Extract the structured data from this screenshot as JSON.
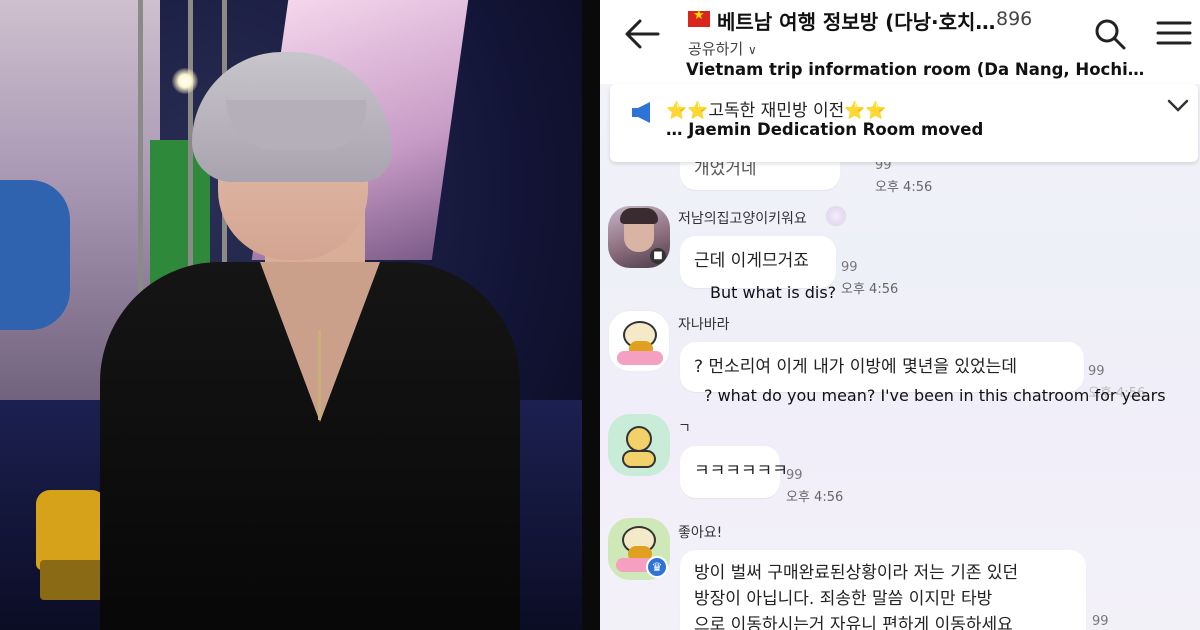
{
  "header": {
    "room_title": "베트남 여행 정보방 (다낭·호치…",
    "member_count": "896",
    "share_label": "공유하기",
    "room_title_en": "Vietnam trip information room (Da Nang, Hochi…"
  },
  "notice": {
    "text": "⭐⭐고독한 재민방 이전⭐⭐",
    "text_en": "… Jaemin Dedication Room moved"
  },
  "messages": [
    {
      "sender": "",
      "text": "개었거네",
      "unread": "99",
      "time": "오후 4:56",
      "translation": ""
    },
    {
      "sender": "저남의집고양이키워요",
      "text": "근데 이게므거죠",
      "unread": "99",
      "time": "오후 4:56",
      "translation": "But what is dis?"
    },
    {
      "sender": "자나바라",
      "text": "? 먼소리여 이게 내가 이방에 몇년을 있었는데",
      "unread": "99",
      "time": "오후 4:56",
      "translation": "? what do you mean? I've been in this chatroom for years"
    },
    {
      "sender": "ㄱ",
      "text": "ㅋㅋㅋㅋㅋㅋ",
      "unread": "99",
      "time": "오후 4:56",
      "translation": ""
    },
    {
      "sender": "좋아요!",
      "text_lines": [
        "방이 벌써 구매완료된상황이라 저는 기존 있던",
        "방장이 아닙니다. 죄송한 말씀 이지만  타방",
        "으로 이동하시는거 자유니 편하게 이동하세요"
      ],
      "unread": "99",
      "time": "",
      "translation": ""
    }
  ],
  "colors": {
    "bubble": "#ffffff",
    "chat_bg": "#f2f1f8",
    "host_badge": "#2e74d6"
  }
}
